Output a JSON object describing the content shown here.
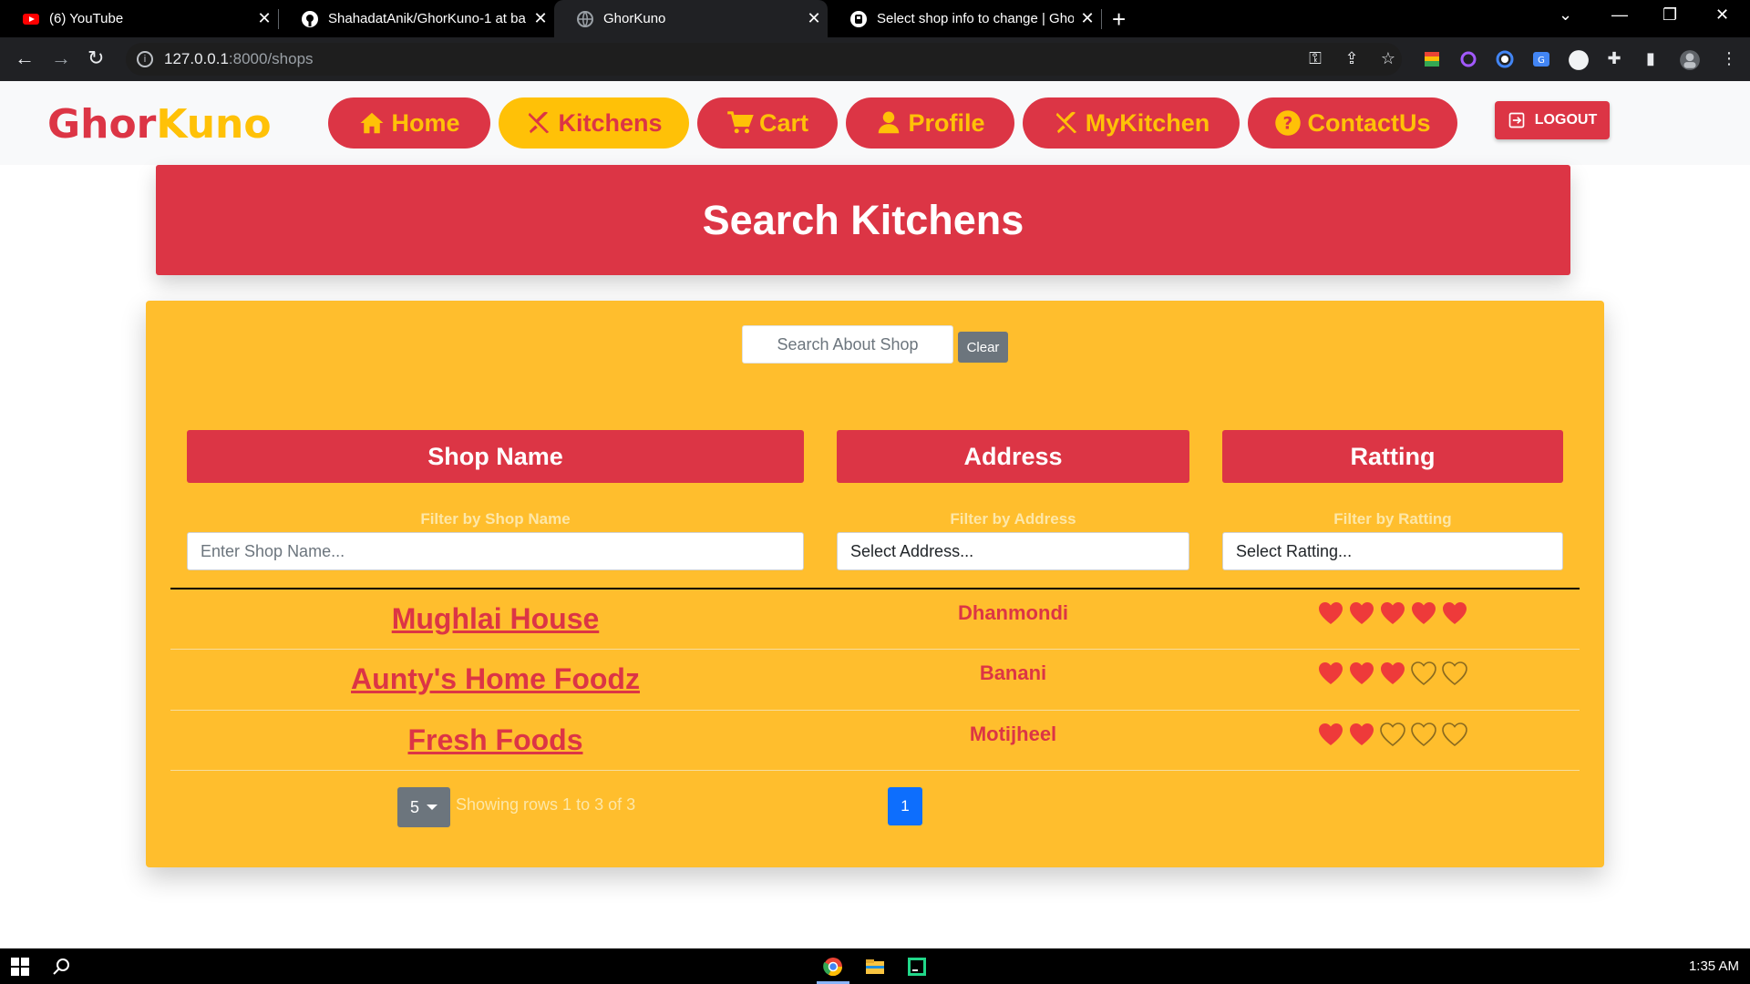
{
  "browser": {
    "tabs": [
      {
        "title": "(6) YouTube",
        "icon": "youtube-icon"
      },
      {
        "title": "ShahadatAnik/GhorKuno-1 at ba",
        "icon": "github-icon"
      },
      {
        "title": "GhorKuno",
        "icon": "globe-icon"
      },
      {
        "title": "Select shop info to change | Ghor",
        "icon": "django-icon"
      }
    ],
    "url_host": "127.0.0.1",
    "url_path": ":8000/shops"
  },
  "header": {
    "logo_part1": "Ghor",
    "logo_part2": "Kuno",
    "nav": [
      {
        "label": "Home",
        "icon": "home-icon"
      },
      {
        "label": "Kitchens",
        "icon": "utensils-icon"
      },
      {
        "label": "Cart",
        "icon": "cart-icon"
      },
      {
        "label": "Profile",
        "icon": "user-icon"
      },
      {
        "label": "MyKitchen",
        "icon": "utensils-icon"
      },
      {
        "label": "ContactUs",
        "icon": "question-icon"
      }
    ],
    "logout_label": "LOGOUT",
    "colors": {
      "primary": "#dc3545",
      "accent": "#ffc107"
    }
  },
  "banner": {
    "title": "Search Kitchens"
  },
  "search": {
    "placeholder": "Search About Shop",
    "clear_label": "Clear"
  },
  "table": {
    "columns": [
      "Shop Name",
      "Address",
      "Ratting"
    ],
    "filters": [
      {
        "label": "Filter by Shop Name",
        "placeholder": "Enter Shop Name..."
      },
      {
        "label": "Filter by Address",
        "value": "Select Address..."
      },
      {
        "label": "Filter by Ratting",
        "value": "Select Ratting..."
      }
    ],
    "rows": [
      {
        "name": "Mughlai House",
        "address": "Dhanmondi",
        "rating": 5
      },
      {
        "name": "Aunty's Home Foodz",
        "address": "Banani",
        "rating": 3
      },
      {
        "name": "Fresh Foods",
        "address": "Motijheel",
        "rating": 2
      }
    ],
    "rating_max": 5
  },
  "pagination": {
    "page_size": "5",
    "rows_info": "Showing rows 1 to 3 of 3",
    "current_page": "1"
  },
  "taskbar": {
    "clock": "1:35 AM"
  }
}
